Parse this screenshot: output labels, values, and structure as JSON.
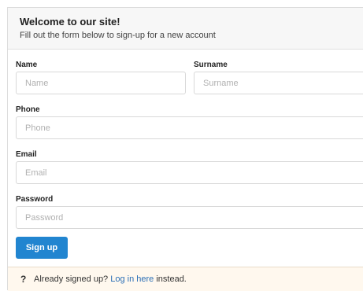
{
  "header": {
    "title": "Welcome to our site!",
    "subtitle": "Fill out the form below to sign-up for a new account"
  },
  "form": {
    "name": {
      "label": "Name",
      "placeholder": "Name",
      "value": ""
    },
    "surname": {
      "label": "Surname",
      "placeholder": "Surname",
      "value": ""
    },
    "phone": {
      "label": "Phone",
      "placeholder": "Phone",
      "value": ""
    },
    "email": {
      "label": "Email",
      "placeholder": "Email",
      "value": ""
    },
    "password": {
      "label": "Password",
      "placeholder": "Password",
      "value": ""
    },
    "submit_label": "Sign up"
  },
  "footer": {
    "icon": "question-mark-icon",
    "icon_glyph": "?",
    "prefix": "Already signed up? ",
    "link_text": "Log in here",
    "suffix": " instead."
  },
  "colors": {
    "primary_button": "#2185d0",
    "link": "#2b6fb6",
    "footer_bg": "#fff8ee",
    "header_bg": "#f7f7f7"
  }
}
